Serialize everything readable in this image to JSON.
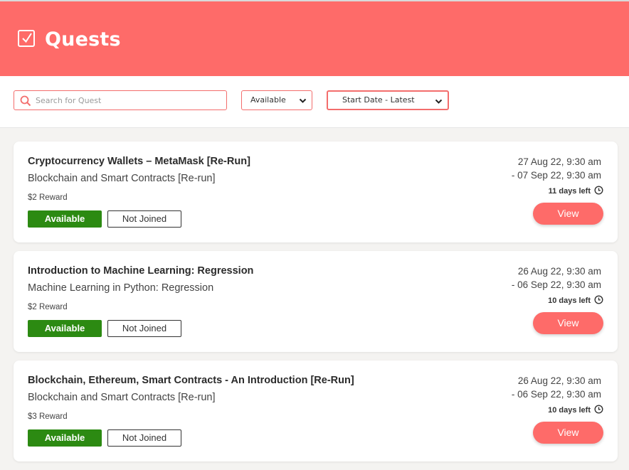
{
  "header": {
    "title": "Quests",
    "icon": "checkbox-icon",
    "bg_color": "#fe6b69"
  },
  "filters": {
    "search_placeholder": "Search for Quest",
    "status_value": "Available",
    "sort_value": "Start Date - Latest"
  },
  "quests": [
    {
      "title": "Cryptocurrency Wallets – MetaMask [Re-Run]",
      "course": "Blockchain and Smart Contracts [Re-run]",
      "reward": "$2 Reward",
      "status": "Available",
      "joined": "Not Joined",
      "start": "27 Aug 22, 9:30 am",
      "end": "- 07 Sep 22, 9:30 am",
      "days_left": "11 days left",
      "action": "View"
    },
    {
      "title": "Introduction to Machine Learning: Regression",
      "course": "Machine Learning in Python: Regression",
      "reward": "$2 Reward",
      "status": "Available",
      "joined": "Not Joined",
      "start": "26 Aug 22, 9:30 am",
      "end": "- 06 Sep 22, 9:30 am",
      "days_left": "10 days left",
      "action": "View"
    },
    {
      "title": "Blockchain, Ethereum, Smart Contracts - An Introduction [Re-Run]",
      "course": "Blockchain and Smart Contracts [Re-run]",
      "reward": "$3 Reward",
      "status": "Available",
      "joined": "Not Joined",
      "start": "26 Aug 22, 9:30 am",
      "end": "- 06 Sep 22, 9:30 am",
      "days_left": "10 days left",
      "action": "View"
    }
  ],
  "colors": {
    "accent": "#fe6b69",
    "available_green": "#2c8a12"
  }
}
